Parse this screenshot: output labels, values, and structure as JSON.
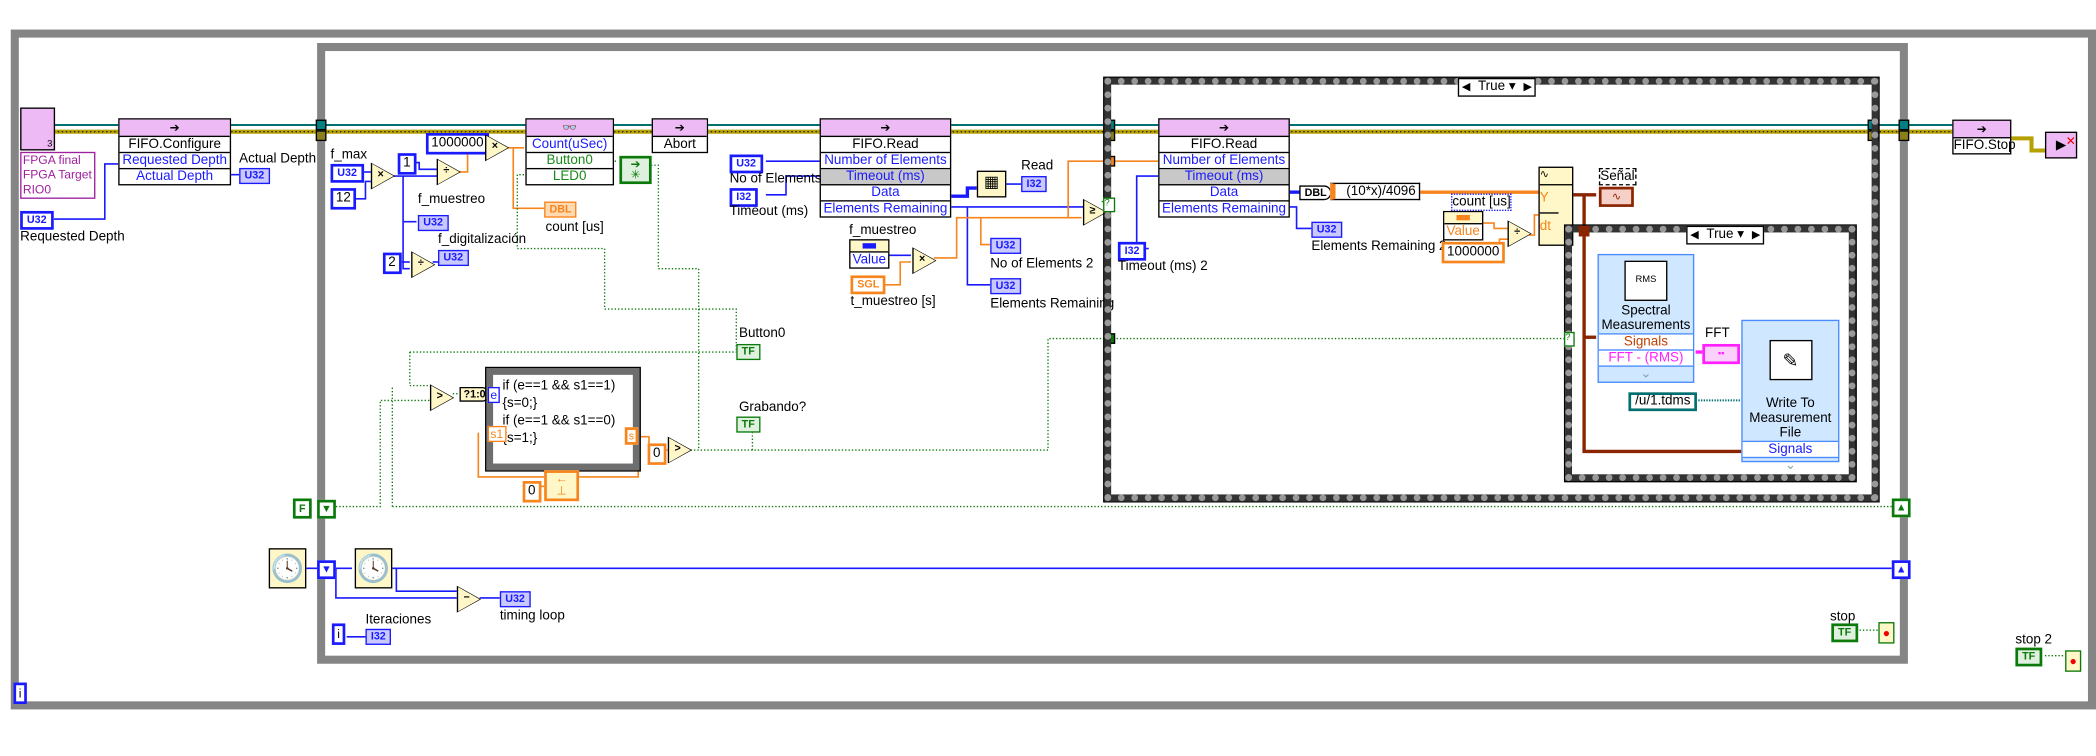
{
  "fpga_ref": {
    "lines": [
      "FPGA final",
      "FPGA Target",
      "RIO0"
    ],
    "badge": "3"
  },
  "requested_depth": {
    "type": "U32",
    "label": "Requested Depth"
  },
  "fifo_configure": {
    "title": "FIFO.Configure",
    "rows": [
      "Requested Depth",
      "Actual Depth"
    ]
  },
  "actual_depth": {
    "type": "U32",
    "label": "Actual Depth"
  },
  "f_max": {
    "label": "f_max",
    "type": "U32"
  },
  "constants": {
    "twelve": "12",
    "one": "1",
    "million": "1000000",
    "two": "2",
    "zero_a": "0",
    "zero_b": "0",
    "million_b": "1000000",
    "false_const": "F"
  },
  "f_muestreo_ind": {
    "label": "f_muestreo",
    "type": "U32"
  },
  "f_digitalizacion": {
    "label": "f_digitalización",
    "type": "U32"
  },
  "count_node": {
    "rows": [
      "Count(uSec)",
      "Button0",
      "LED0"
    ]
  },
  "count_us_ind": {
    "label": "count [us]",
    "type": "DBL"
  },
  "abort_node": {
    "title": "Abort"
  },
  "fifo_read_1": {
    "title": "FIFO.Read",
    "rows": [
      "Number of Elements",
      "Timeout (ms)",
      "Data",
      "Elements Remaining"
    ]
  },
  "no_of_elements": {
    "label": "No of Elements",
    "type": "U32"
  },
  "timeout_ms": {
    "label": "Timeout (ms)",
    "type": "I32"
  },
  "read_ind": {
    "label": "Read",
    "type": "I32"
  },
  "f_muestreo_prop": {
    "label": "f_muestreo",
    "row": "Value"
  },
  "t_muestreo": {
    "label": "t_muestreo [s]",
    "type": "SGL"
  },
  "no_of_elements_2": {
    "label": "No of Elements 2",
    "type": "U32"
  },
  "elements_remaining": {
    "label": "Elements Remaining",
    "type": "U32"
  },
  "case_outer": {
    "selector": "True"
  },
  "case_inner": {
    "selector": "True"
  },
  "fifo_read_2": {
    "title": "FIFO.Read",
    "rows": [
      "Number of Elements",
      "Timeout (ms)",
      "Data",
      "Elements Remaining"
    ]
  },
  "timeout_ms_2": {
    "label": "Timeout (ms) 2",
    "type": "I32"
  },
  "to_dbl": "DBL",
  "expression": "(10*x)/4096",
  "elements_remaining_2": {
    "label": "Elements Remaining 2",
    "type": "U32"
  },
  "count_us_prop": {
    "label": "count [us]",
    "row": "Value"
  },
  "build_waveform": {
    "rows": [
      "Y",
      "dt"
    ]
  },
  "senal": {
    "label": "Señal"
  },
  "spectral": {
    "title": [
      "Spectral",
      "Measurements"
    ],
    "rows": [
      "Signals",
      "FFT - (RMS)"
    ],
    "icon_text": "RMS"
  },
  "fft_ind": {
    "label": "FFT"
  },
  "write_file": {
    "title": [
      "Write To",
      "Measurement",
      "File"
    ],
    "rows": [
      "Signals"
    ]
  },
  "path_const": "/u/1.tdms",
  "button0_ind": {
    "label": "Button0",
    "type": "TF"
  },
  "grabando_ind": {
    "label": "Grabando?",
    "type": "TF"
  },
  "select_node": "?1:0",
  "formula_node": {
    "lines": [
      "if (e==1 && s1==1)",
      "{s=0;}",
      "if (e==1 && s1==0)",
      "{s=1;}"
    ],
    "inputs": [
      "e",
      "s1"
    ],
    "output": "s"
  },
  "timing_loop": {
    "label": "timing loop",
    "type": "U32"
  },
  "iteraciones": {
    "label": "Iteraciones",
    "type": "I32",
    "iter": "i"
  },
  "stop": {
    "label": "stop",
    "type": "TF"
  },
  "stop2": {
    "label": "stop 2",
    "type": "TF"
  },
  "outer_iter": "i",
  "fifo_stop": {
    "title": "FIFO.Stop"
  },
  "colors": {
    "integer": "#1a1aff",
    "float": "#f7851e",
    "boolean": "#0b7a0b",
    "refnum": "#006f6f",
    "error": "#b5a000",
    "waveform": "#8b2500",
    "node_header": "#eebaf5",
    "express_vi": "#cfe7ff"
  }
}
